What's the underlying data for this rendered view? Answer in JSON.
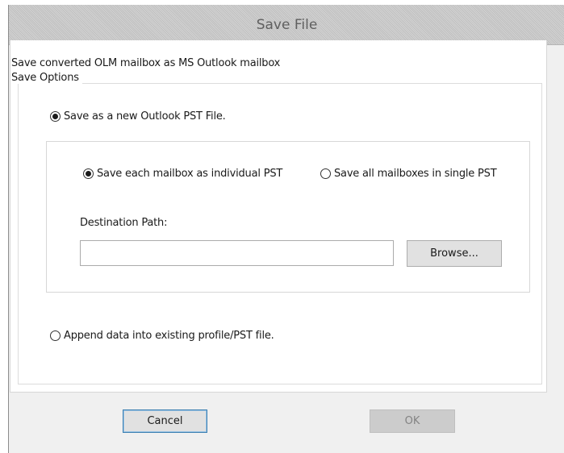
{
  "dialog": {
    "title": "Save File",
    "subtitle": "Save converted OLM mailbox as MS Outlook mailbox",
    "group_label": "Save Options"
  },
  "options": {
    "new_pst": {
      "label": "Save as a new Outlook PST File.",
      "checked": true
    },
    "individual_pst": {
      "label": "Save each mailbox as individual PST",
      "checked": true
    },
    "single_pst": {
      "label": "Save all mailboxes in single PST",
      "checked": false
    },
    "append": {
      "label": "Append data into existing profile/PST file.",
      "checked": false
    }
  },
  "destination": {
    "label": "Destination Path:",
    "value": "",
    "browse_label": "Browse..."
  },
  "buttons": {
    "cancel_label": "Cancel",
    "ok_label": "OK",
    "ok_enabled": false
  }
}
